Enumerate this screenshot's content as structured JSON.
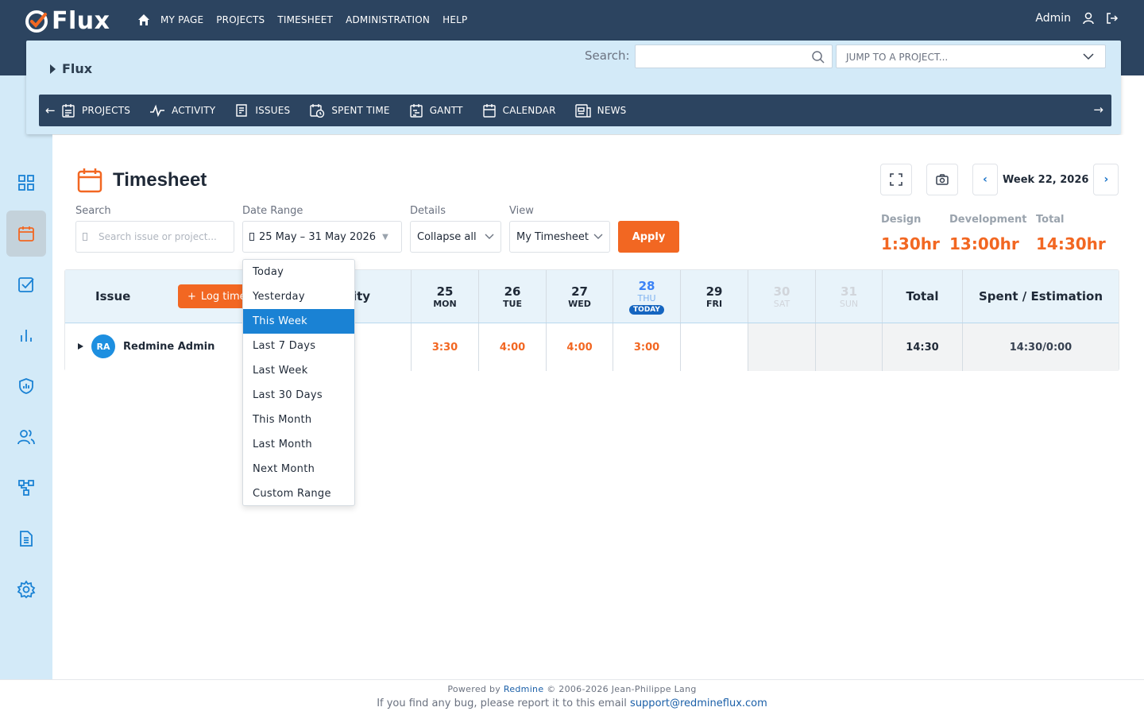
{
  "app": {
    "logo_text": "Flux",
    "top_nav": [
      "MY PAGE",
      "PROJECTS",
      "TIMESHEET",
      "ADMINISTRATION",
      "HELP"
    ],
    "user_name": "Admin"
  },
  "project": {
    "name": "Flux",
    "search_label": "Search:",
    "search_value": "",
    "jump_placeholder": "JUMP TO A PROJECT...",
    "menu": [
      {
        "label": "PROJECTS",
        "icon": "projects-icon"
      },
      {
        "label": "ACTIVITY",
        "icon": "activity-icon"
      },
      {
        "label": "ISSUES",
        "icon": "issues-icon"
      },
      {
        "label": "SPENT TIME",
        "icon": "spent-time-icon"
      },
      {
        "label": "GANTT",
        "icon": "gantt-icon"
      },
      {
        "label": "CALENDAR",
        "icon": "calendar-icon"
      },
      {
        "label": "NEWS",
        "icon": "news-icon"
      }
    ]
  },
  "sidebar": {
    "icons": [
      "dashboard-icon",
      "calendar-icon",
      "checkbox-icon",
      "chart-icon",
      "shield-icon",
      "users-icon",
      "workflow-icon",
      "document-icon",
      "settings-icon"
    ],
    "active": "calendar-icon"
  },
  "timesheet": {
    "title": "Timesheet",
    "week_label": "Week 22, 2026",
    "filters": {
      "search_label": "Search",
      "search_placeholder": "Search issue or project...",
      "date_range_label": "Date Range",
      "date_range_value": "25 May – 31 May 2026",
      "details_label": "Details",
      "details_value": "Collapse all",
      "view_label": "View",
      "view_value": "My Timesheet",
      "apply_label": "Apply"
    },
    "stats": [
      {
        "label": "Design",
        "value": "1:30hr"
      },
      {
        "label": "Development",
        "value": "13:00hr"
      },
      {
        "label": "Total",
        "value": "14:30hr"
      }
    ],
    "table": {
      "issue_header": "Issue",
      "log_time_label": "Log time",
      "activity_header_fragment": "ity",
      "days": [
        {
          "num": "25",
          "name": "MON",
          "state": "normal"
        },
        {
          "num": "26",
          "name": "TUE",
          "state": "normal"
        },
        {
          "num": "27",
          "name": "WED",
          "state": "normal"
        },
        {
          "num": "28",
          "name": "THU",
          "state": "today",
          "badge": "TODAY"
        },
        {
          "num": "29",
          "name": "FRI",
          "state": "normal"
        },
        {
          "num": "30",
          "name": "SAT",
          "state": "weekend"
        },
        {
          "num": "31",
          "name": "SUN",
          "state": "weekend"
        }
      ],
      "total_header": "Total",
      "spent_header": "Spent / Estimation",
      "rows": [
        {
          "avatar": "RA",
          "user": "Redmine Admin",
          "values": [
            "3:30",
            "4:00",
            "4:00",
            "3:00",
            "",
            "",
            ""
          ],
          "total": "14:30",
          "spent": "14:30/0:00"
        }
      ]
    },
    "date_range_options": [
      "Today",
      "Yesterday",
      "This Week",
      "Last 7 Days",
      "Last Week",
      "Last 30 Days",
      "This Month",
      "Last Month",
      "Next Month",
      "Custom Range"
    ],
    "date_range_selected": "This Week"
  },
  "footer": {
    "powered_prefix": "Powered by",
    "powered_link": "Redmine",
    "powered_suffix": "© 2006-2026 Jean-Philippe Lang",
    "bug_text": "If you find any bug, please report it to this email",
    "bug_email": "support@redmineflux.com"
  },
  "colors": {
    "navy": "#2c4460",
    "light_blue": "#d3eaf8",
    "accent_orange": "#f26722",
    "selected_blue": "#1a82d4"
  }
}
